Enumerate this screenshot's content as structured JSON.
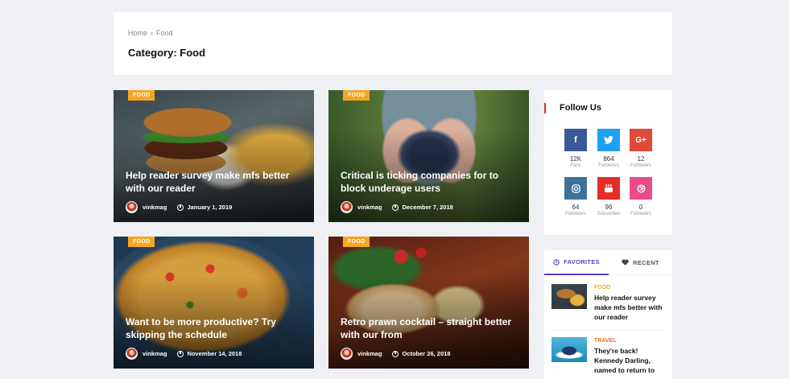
{
  "breadcrumb": {
    "home": "Home",
    "separator": "›",
    "current": "Food"
  },
  "page_title": "Category: Food",
  "posts": [
    {
      "tag": "FOOD",
      "title": "Help reader survey make mfs better with our reader",
      "author": "vinkmag",
      "date": "January 1, 2019"
    },
    {
      "tag": "FOOD",
      "title": "Critical is ticking companies for to block underage users",
      "author": "vinkmag",
      "date": "December 7, 2018"
    },
    {
      "tag": "FOOD",
      "title": "Want to be more productive? Try skipping the schedule",
      "author": "vinkmag",
      "date": "November 14, 2018"
    },
    {
      "tag": "FOOD",
      "title": "Retro prawn cocktail – straight better with our from",
      "author": "vinkmag",
      "date": "October 26, 2018"
    }
  ],
  "follow": {
    "title": "Follow Us",
    "networks": [
      {
        "icon": "f",
        "count": "12K",
        "label": "Fans",
        "color": "#3b5998"
      },
      {
        "icon": "t",
        "count": "864",
        "label": "Followers",
        "color": "#1da1f2"
      },
      {
        "icon": "G+",
        "count": "12",
        "label": "Followers",
        "color": "#dd4b39"
      },
      {
        "icon": "ig",
        "count": "64",
        "label": "Followers",
        "color": "#3f729b"
      },
      {
        "icon": "yt",
        "count": "96",
        "label": "Subscriber",
        "color": "#e52d27"
      },
      {
        "icon": "dr",
        "count": "0",
        "label": "Followers",
        "color": "#ea4c89"
      }
    ]
  },
  "sidebar_tabs": {
    "favorites": "FAVORITES",
    "recent": "RECENT",
    "items": [
      {
        "category": "FOOD",
        "category_color": "#f5a623",
        "title": "Help reader survey make mfs better with our reader"
      },
      {
        "category": "TRAVEL",
        "category_color": "#f0701e",
        "title": "They're back! Kennedy Darling, named to return to"
      }
    ]
  }
}
